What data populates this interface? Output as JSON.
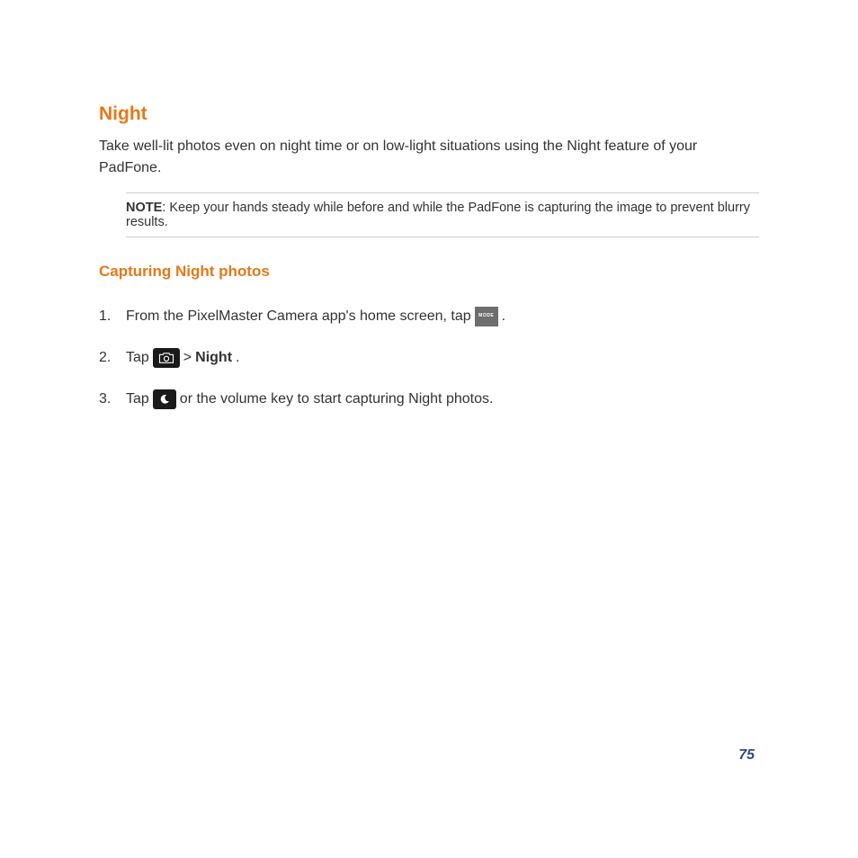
{
  "page": {
    "heading_primary": "Night",
    "intro": "Take well-lit photos even on night time or on low-light situations using the Night feature of your PadFone.",
    "note": {
      "label": "NOTE",
      "text": ": Keep your hands steady while before and while the PadFone is capturing the image to prevent blurry results."
    },
    "heading_secondary": "Capturing Night photos",
    "steps": {
      "s1": {
        "num": "1.",
        "text_before": "From the PixelMaster Camera app's home screen, tap ",
        "text_after": "."
      },
      "s2": {
        "num": "2.",
        "text_a": "Tap ",
        "text_b": " > ",
        "bold": "Night",
        "text_c": "."
      },
      "s3": {
        "num": "3.",
        "text_a": "Tap ",
        "text_b": " or the volume key to start capturing Night photos."
      }
    },
    "mode_label": "MODE",
    "page_number": "75"
  }
}
